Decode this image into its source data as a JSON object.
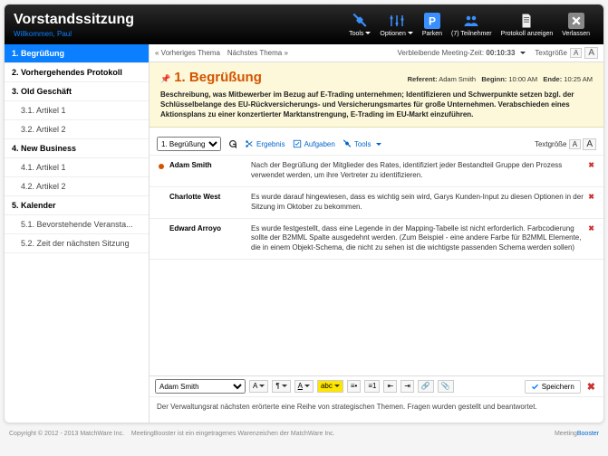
{
  "header": {
    "title": "Vorstandssitzung",
    "welcome": "Willkommen, Paul",
    "buttons": {
      "tools": "Tools",
      "options": "Optionen",
      "park": "Parken",
      "attendees": "(7) Teilnehmer",
      "protocol": "Protokoll anzeigen",
      "leave": "Verlassen"
    }
  },
  "sidebar": [
    {
      "label": "1. Begrüßung",
      "bold": true,
      "active": true
    },
    {
      "label": "2. Vorhergehendes Protokoll",
      "bold": true
    },
    {
      "label": "3. Old Geschäft",
      "bold": true
    },
    {
      "label": "3.1. Artikel 1",
      "indent": true
    },
    {
      "label": "3.2. Artikel 2",
      "indent": true
    },
    {
      "label": "4. New Business",
      "bold": true
    },
    {
      "label": "4.1. Artikel 1",
      "indent": true
    },
    {
      "label": "4.2. Artikel 2",
      "indent": true
    },
    {
      "label": "5. Kalender",
      "bold": true
    },
    {
      "label": "5.1. Bevorstehende Veransta...",
      "indent": true
    },
    {
      "label": "5.2. Zeit der nächsten Sitzung",
      "indent": true
    }
  ],
  "topbar": {
    "prev": "« Vorheriges Thema",
    "next": "Nächstes Thema »",
    "remaining_label": "Verbleibende Meeting-Zeit:",
    "remaining_time": "00:10:33",
    "textsize": "Textgröße"
  },
  "topic": {
    "title": "1. Begrüßung",
    "referent_label": "Referent:",
    "referent": "Adam Smith",
    "begin_label": "Beginn:",
    "begin": "10:00 AM",
    "end_label": "Ende:",
    "end": "10:25 AM",
    "desc": "Beschreibung, was Mitbewerber im Bezug auf E-Trading unternehmen; Identifizieren und Schwerpunkte setzen bzgl. der Schlüsselbelange des EU-Rückversicherungs- und Versicherungsmartes für große Unternehmen. Verabschieden eines Aktionsplans zu einer konzertierter Marktanstrengung, E-Trading im EU-Markt einzuführen."
  },
  "toolbar2": {
    "select": "1. Begrüßung",
    "result": "Ergebnis",
    "tasks": "Aufgaben",
    "tools": "Tools",
    "textsize": "Textgröße"
  },
  "notes": [
    {
      "bullet": true,
      "author": "Adam Smith",
      "text": "Nach der Begrüßung der Mitglieder des Rates, identifiziert jeder Bestandteil Gruppe den Prozess verwendet werden, um ihre Vertreter zu identifizieren."
    },
    {
      "bullet": false,
      "author": "Charlotte West",
      "text": "Es wurde darauf hingewiesen, dass es wichtig sein wird, Garys Kunden-Input zu diesen Optionen in der Sitzung im Oktober zu bekommen."
    },
    {
      "bullet": false,
      "author": "Edward Arroyo",
      "text": "Es wurde festgestellt, dass eine Legende in der Mapping-Tabelle ist nicht erforderlich. Farbcodierung sollte der B2MML Spalte ausgedehnt werden. (Zum Beispiel - eine andere Farbe für B2MML Elemente, die in einem Objekt-Schema, die nicht zu sehen ist die wichtigste passenden Schema werden sollen)"
    }
  ],
  "editor": {
    "author_select": "Adam Smith",
    "save": "Speichern",
    "content": "Der Verwaltungsrat nächsten erörterte eine Reihe von strategischen Themen. Fragen wurden gestellt und beantwortet."
  },
  "footer": {
    "copyright": "Copyright © 2012 - 2013 MatchWare Inc.",
    "trademark": "MeetingBooster ist ein eingetragenes Warenzeichen der MatchWare Inc.",
    "brand_prefix": "Meeting",
    "brand_suffix": "Booster"
  }
}
